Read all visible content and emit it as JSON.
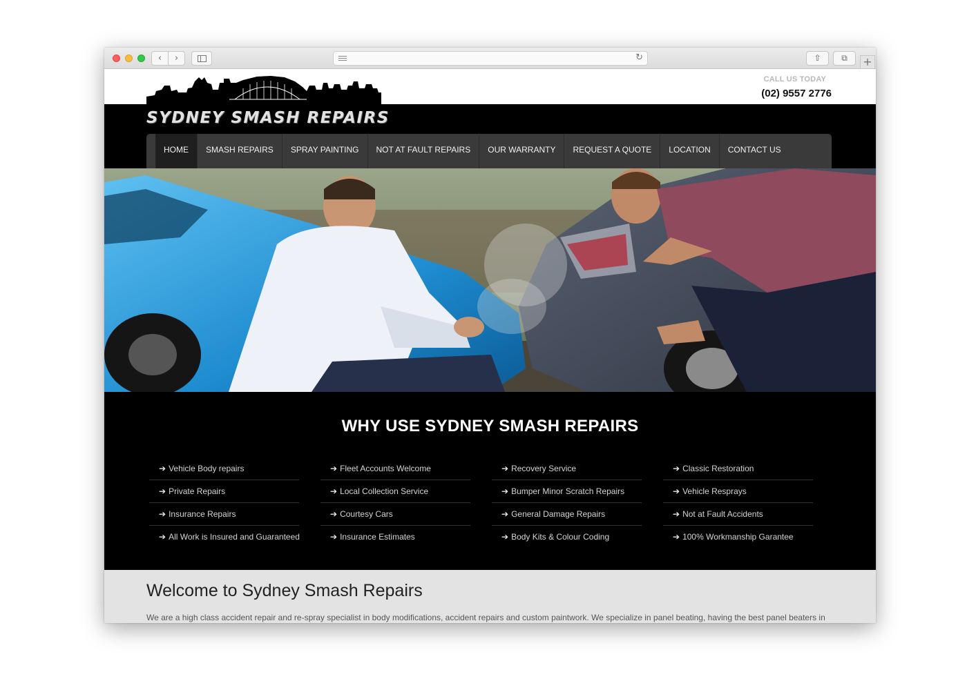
{
  "browser": {
    "back_glyph": "‹",
    "forward_glyph": "›",
    "reload_glyph": "↻",
    "share_glyph": "⇧",
    "tabs_glyph": "⧉",
    "newtab_glyph": "+"
  },
  "header": {
    "logo_text": "SYDNEY SMASH REPAIRS",
    "call_label": "CALL US TODAY",
    "phone": "(02) 9557 2776"
  },
  "nav": {
    "items": [
      "HOME",
      "SMASH REPAIRS",
      "SPRAY PAINTING",
      "NOT AT FAULT REPAIRS",
      "OUR WARRANTY",
      "REQUEST A QUOTE",
      "LOCATION",
      "CONTACT US"
    ],
    "active_index": 0
  },
  "why": {
    "title": "WHY USE SYDNEY SMASH REPAIRS",
    "arrow_glyph": "➔",
    "columns": [
      [
        "Vehicle Body repairs",
        "Private Repairs",
        "Insurance Repairs",
        "All Work is Insured and Guaranteed"
      ],
      [
        "Fleet Accounts Welcome",
        "Local Collection Service",
        "Courtesy Cars",
        "Insurance Estimates"
      ],
      [
        "Recovery Service",
        "Bumper Minor Scratch Repairs",
        "General Damage Repairs",
        "Body Kits & Colour Coding"
      ],
      [
        "Classic Restoration",
        "Vehicle Resprays",
        "Not at Fault Accidents",
        "100% Workmanship Garantee"
      ]
    ]
  },
  "welcome": {
    "title": "Welcome to Sydney Smash Repairs",
    "text": "We are a high class accident repair and re-spray specialist in body modifications, accident repairs and custom paintwork. We specialize in panel beating, having the best panel beaters in"
  },
  "colors": {
    "nav_bg": "#3a3a3a",
    "nav_active": "#1f1f1f",
    "page_bg": "#000000",
    "welcome_bg": "#e3e3e3"
  }
}
